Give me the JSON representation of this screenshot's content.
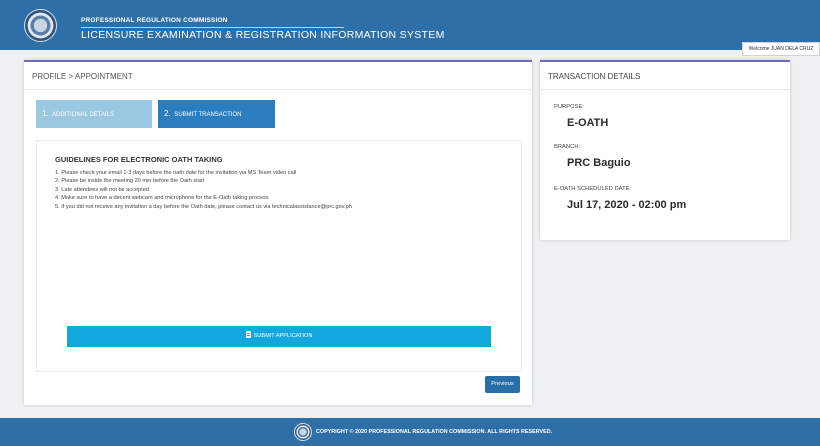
{
  "header": {
    "org": "PROFESSIONAL REGULATION COMMISSION",
    "system": "LICENSURE EXAMINATION & REGISTRATION INFORMATION SYSTEM"
  },
  "welcome": "Welcome JUAN DELA CRUZ",
  "breadcrumb": "PROFILE > APPOINTMENT",
  "steps": [
    {
      "num": "1.",
      "label": "ADDITIONAL DETAILS"
    },
    {
      "num": "2.",
      "label": "SUBMIT TRANSACTION"
    }
  ],
  "guidelines": {
    "title": "GUIDELINES FOR ELECTRONIC OATH TAKING",
    "items": [
      "1. Please check your email 1-3 days before the oath date for the invitation via MS Team video call",
      "2. Please be inside the meeting 20 min before the Oath start",
      "3. Late attendees will not be accepted",
      "4. Make sure to have a decent webcam and microphone for the E-Oath taking process",
      "5. If you did not receive any invitation a day before the Oath date, please contact us via technicalassistance@prc.gov.ph"
    ]
  },
  "buttons": {
    "submit": "SUBMIT APPLICATION",
    "previous": "Previous"
  },
  "transaction": {
    "title": "TRANSACTION DETAILS",
    "purpose_label": "PURPOSE:",
    "purpose": "E-OATH",
    "branch_label": "BRANCH:",
    "branch": "PRC Baguio",
    "date_label": "E-OATH SCHEDULED DATE:",
    "date": "Jul 17, 2020 - 02:00 pm"
  },
  "footer": {
    "copyright": "COPYRIGHT © 2020 PROFESSIONAL REGULATION COMMISSION. ALL RIGHTS RESERVED."
  },
  "icons": {
    "header_logo": "prc-seal-icon",
    "submit": "document-icon",
    "footer_logo": "prc-seal-icon"
  },
  "colors": {
    "brand_blue": "#2f6fa8",
    "submit_button": "#14a7dd",
    "active_step": "#2a7ec0",
    "inactive_step": "#9cc7e0"
  }
}
